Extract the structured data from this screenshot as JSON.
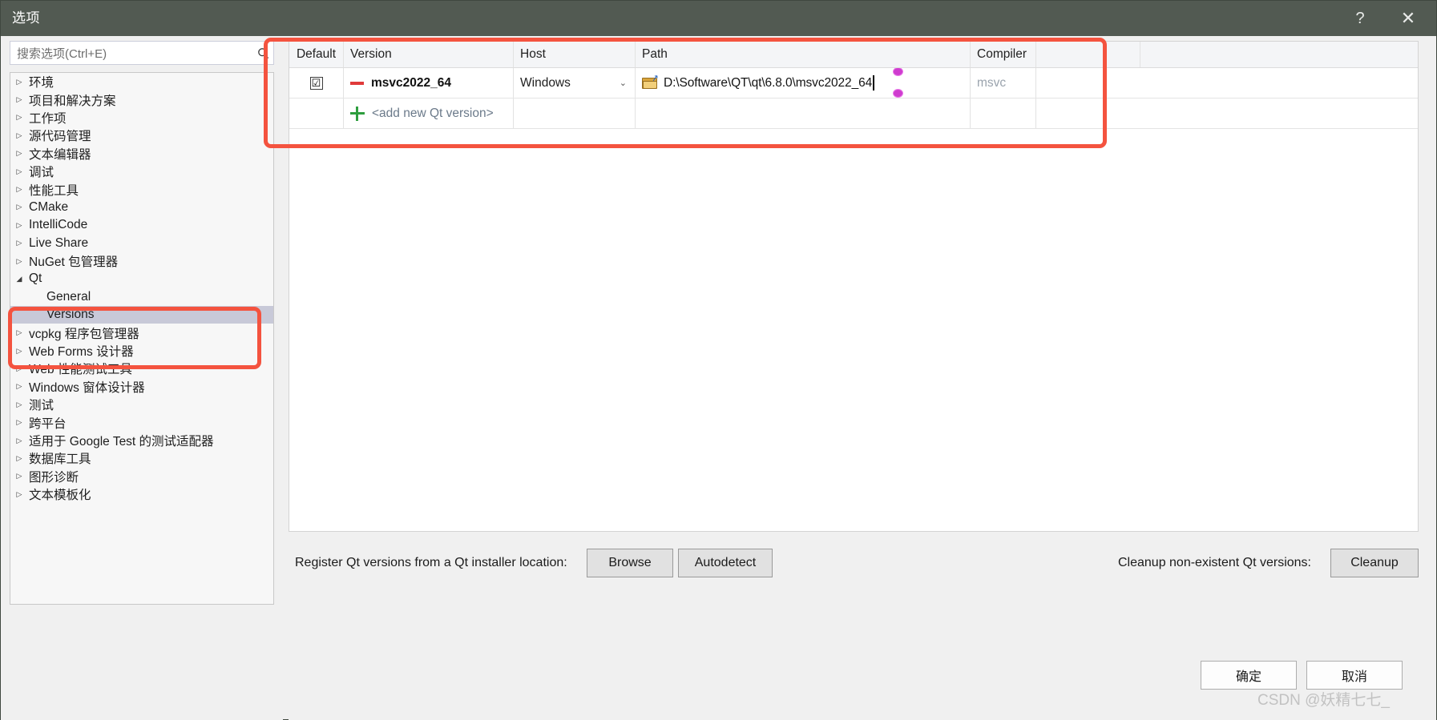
{
  "window": {
    "title": "选项",
    "help_icon": "question-mark-icon",
    "help_label": "?",
    "close_icon": "close-icon",
    "close_label": "✕",
    "titlebar_color": "#525a52"
  },
  "search": {
    "placeholder": "搜索选项(Ctrl+E)",
    "icon": "search-icon"
  },
  "sidebar": {
    "items": [
      {
        "label": "环境",
        "level": 0,
        "expandable": true,
        "expanded": false,
        "selected": false
      },
      {
        "label": "项目和解决方案",
        "level": 0,
        "expandable": true,
        "expanded": false,
        "selected": false
      },
      {
        "label": "工作项",
        "level": 0,
        "expandable": true,
        "expanded": false,
        "selected": false
      },
      {
        "label": "源代码管理",
        "level": 0,
        "expandable": true,
        "expanded": false,
        "selected": false
      },
      {
        "label": "文本编辑器",
        "level": 0,
        "expandable": true,
        "expanded": false,
        "selected": false
      },
      {
        "label": "调试",
        "level": 0,
        "expandable": true,
        "expanded": false,
        "selected": false
      },
      {
        "label": "性能工具",
        "level": 0,
        "expandable": true,
        "expanded": false,
        "selected": false
      },
      {
        "label": "CMake",
        "level": 0,
        "expandable": true,
        "expanded": false,
        "selected": false
      },
      {
        "label": "IntelliCode",
        "level": 0,
        "expandable": true,
        "expanded": false,
        "selected": false
      },
      {
        "label": "Live Share",
        "level": 0,
        "expandable": true,
        "expanded": false,
        "selected": false
      },
      {
        "label": "NuGet 包管理器",
        "level": 0,
        "expandable": true,
        "expanded": false,
        "selected": false
      },
      {
        "label": "Qt",
        "level": 0,
        "expandable": true,
        "expanded": true,
        "selected": false
      },
      {
        "label": "General",
        "level": 1,
        "expandable": false,
        "expanded": false,
        "selected": false
      },
      {
        "label": "Versions",
        "level": 1,
        "expandable": false,
        "expanded": false,
        "selected": true
      },
      {
        "label": "vcpkg 程序包管理器",
        "level": 0,
        "expandable": true,
        "expanded": false,
        "selected": false
      },
      {
        "label": "Web Forms 设计器",
        "level": 0,
        "expandable": true,
        "expanded": false,
        "selected": false
      },
      {
        "label": "Web 性能测试工具",
        "level": 0,
        "expandable": true,
        "expanded": false,
        "selected": false
      },
      {
        "label": "Windows 窗体设计器",
        "level": 0,
        "expandable": true,
        "expanded": false,
        "selected": false
      },
      {
        "label": "测试",
        "level": 0,
        "expandable": true,
        "expanded": false,
        "selected": false
      },
      {
        "label": "跨平台",
        "level": 0,
        "expandable": true,
        "expanded": false,
        "selected": false
      },
      {
        "label": "适用于 Google Test 的测试适配器",
        "level": 0,
        "expandable": true,
        "expanded": false,
        "selected": false
      },
      {
        "label": "数据库工具",
        "level": 0,
        "expandable": true,
        "expanded": false,
        "selected": false
      },
      {
        "label": "图形诊断",
        "level": 0,
        "expandable": true,
        "expanded": false,
        "selected": false
      },
      {
        "label": "文本模板化",
        "level": 0,
        "expandable": true,
        "expanded": false,
        "selected": false
      }
    ],
    "collapsed_arrow": "▷",
    "expanded_arrow": "◢"
  },
  "grid": {
    "columns": [
      "Default",
      "Version",
      "Host",
      "Path",
      "Compiler",
      ""
    ],
    "rows": [
      {
        "default_checked": true,
        "checkmark": "☑",
        "version_icon": "minus-icon",
        "version": "msvc2022_64",
        "host": "Windows",
        "host_chevron": "⌄",
        "path_icon": "folder-open-icon",
        "path": "D:\\Software\\QT\\qt\\6.8.0\\msvc2022_64",
        "compiler": "msvc"
      }
    ],
    "add_row": {
      "icon": "plus-icon",
      "label": "<add new Qt version>"
    }
  },
  "actions": {
    "register_label": "Register Qt versions from a Qt installer location:",
    "browse": "Browse",
    "autodetect": "Autodetect",
    "cleanup_label": "Cleanup non-existent Qt versions:",
    "cleanup": "Cleanup"
  },
  "footer": {
    "ok": "确定",
    "cancel": "取消"
  },
  "watermark": "CSDN @妖精七七_"
}
